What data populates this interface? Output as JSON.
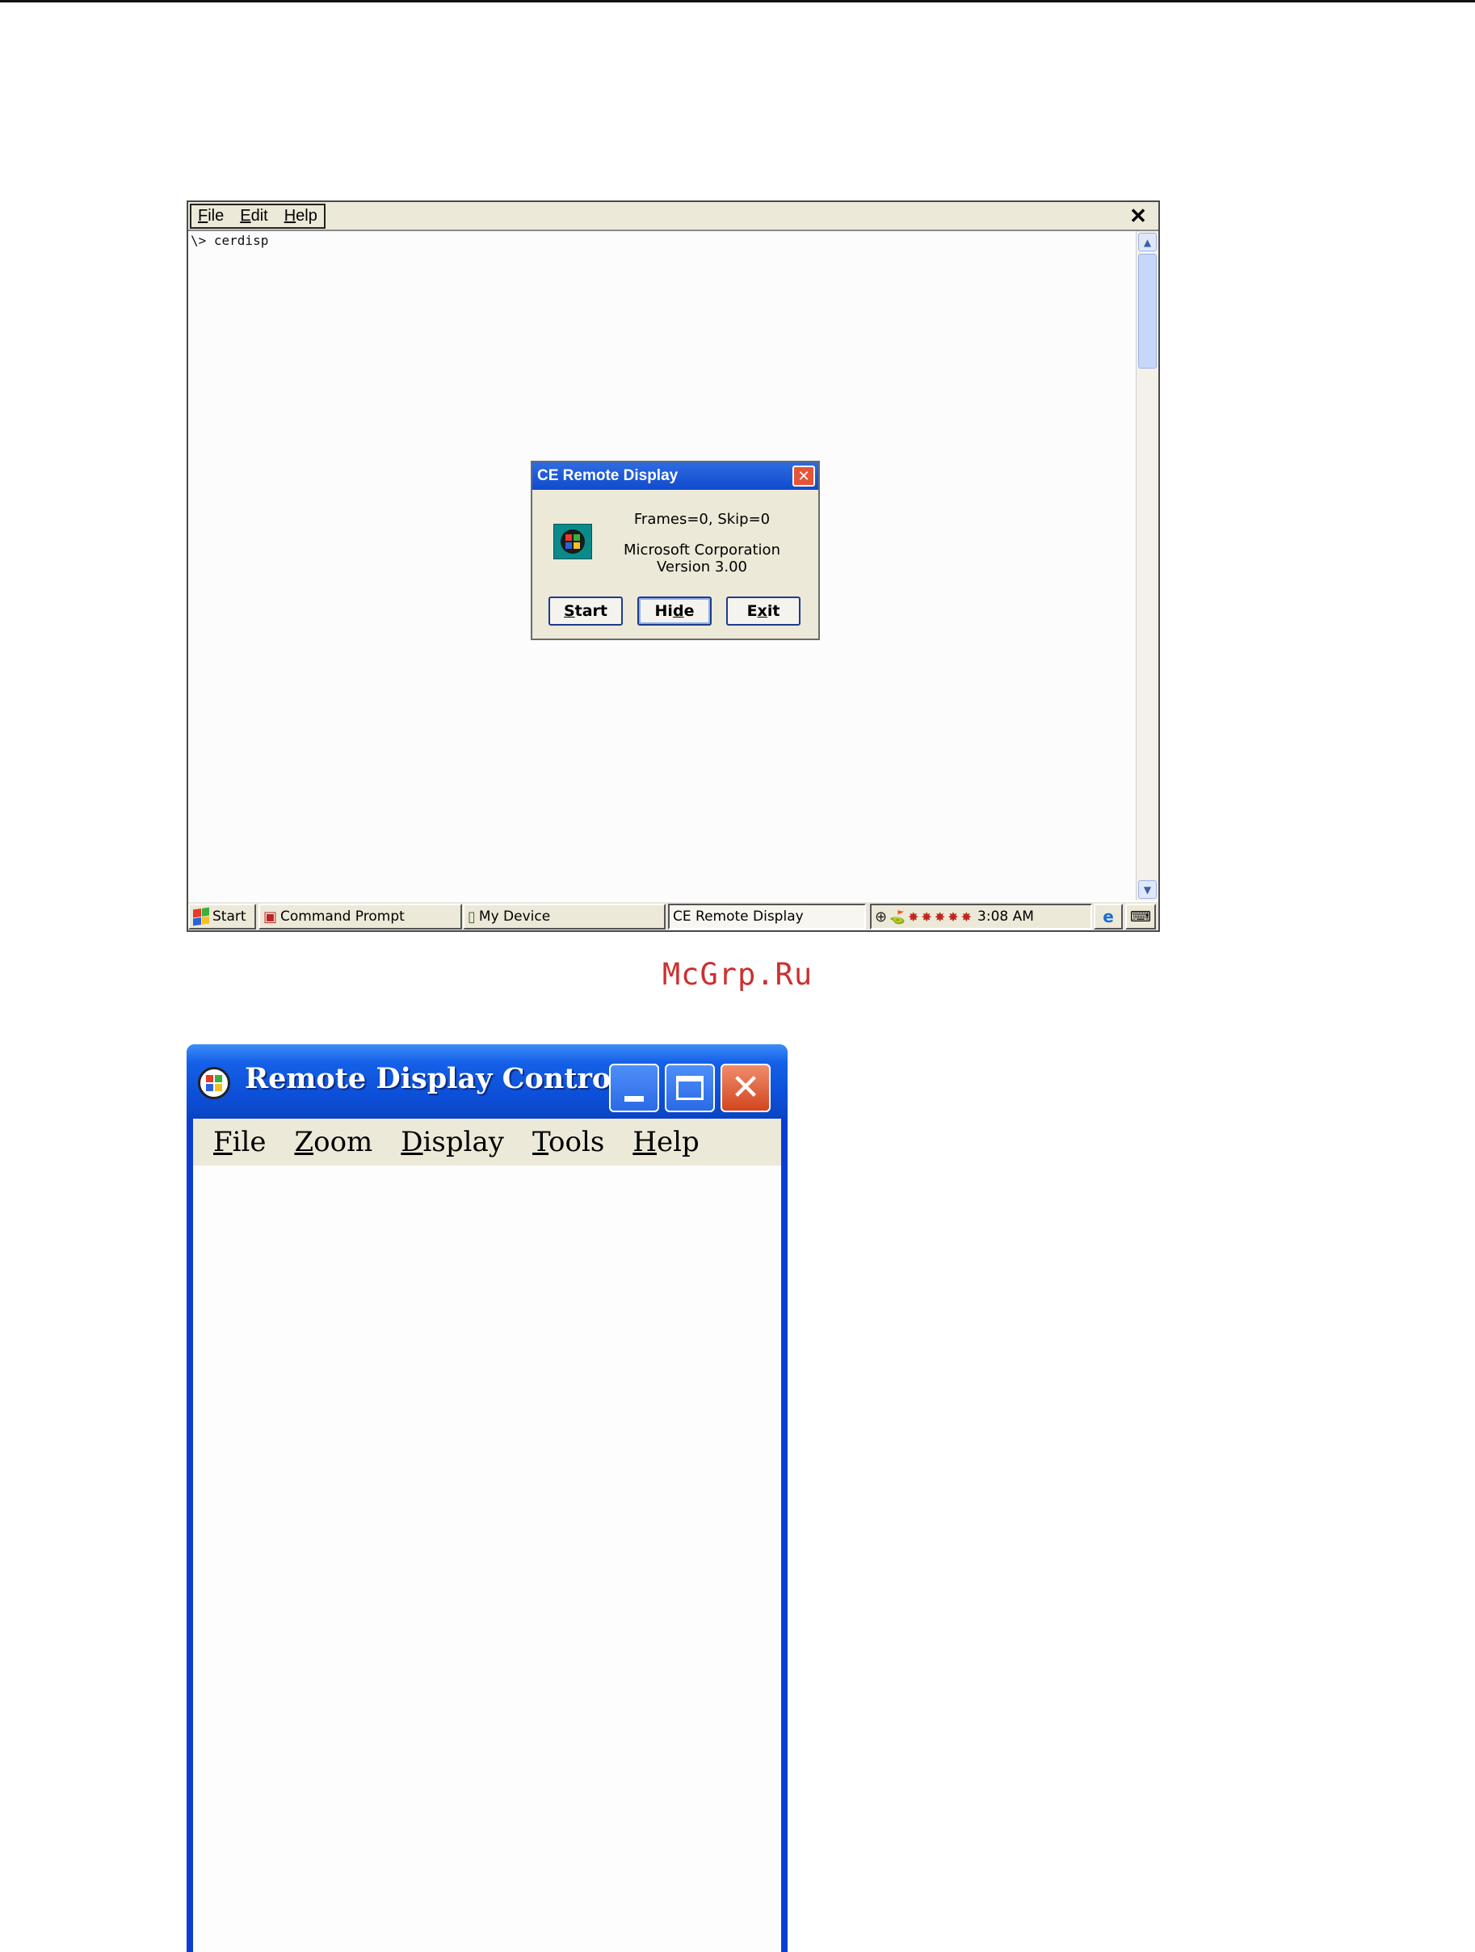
{
  "ce_window": {
    "menu": [
      {
        "accel": "F",
        "rest": "ile"
      },
      {
        "accel": "E",
        "rest": "dit"
      },
      {
        "accel": "H",
        "rest": "elp"
      }
    ],
    "close_glyph": "✕",
    "console_line": "\\> cerdisp",
    "scrollbar": {
      "up_icon": "chevron-up-icon",
      "down_icon": "chevron-down-icon"
    }
  },
  "dialog": {
    "title": "CE Remote Display",
    "close_glyph": "✕",
    "frames_text": "Frames=0, Skip=0",
    "company": "Microsoft Corporation",
    "version": "Version 3.00",
    "buttons": [
      {
        "accel": "S",
        "rest": "tart"
      },
      {
        "pre": "Hi",
        "accel": "d",
        "rest": "e"
      },
      {
        "pre": "E",
        "accel": "x",
        "rest": "it"
      }
    ]
  },
  "taskbar": {
    "start": "Start",
    "command_prompt": "Command Prompt",
    "my_device": "My Device",
    "remote_display": "CE Remote Display",
    "clock": "3:08 AM",
    "tray_icons": [
      "network-icon",
      "flag-icon",
      "app-icon",
      "app-icon",
      "app-icon",
      "app-icon",
      "app-icon"
    ]
  },
  "watermark": "McGrp.Ru",
  "control_window": {
    "title": "Remote Display Contro...",
    "menu": [
      {
        "accel": "F",
        "rest": "ile"
      },
      {
        "accel": "Z",
        "rest": "oom"
      },
      {
        "accel": "D",
        "rest": "isplay"
      },
      {
        "accel": "T",
        "rest": "ools"
      },
      {
        "accel": "H",
        "rest": "elp"
      }
    ]
  },
  "colors": {
    "xp_title_blue": "#0c4fd8",
    "ce_title_blue": "#1a55d6",
    "close_red": "#d2461f",
    "watermark_red": "#cc3030",
    "menubar_beige": "#ece9d8"
  }
}
